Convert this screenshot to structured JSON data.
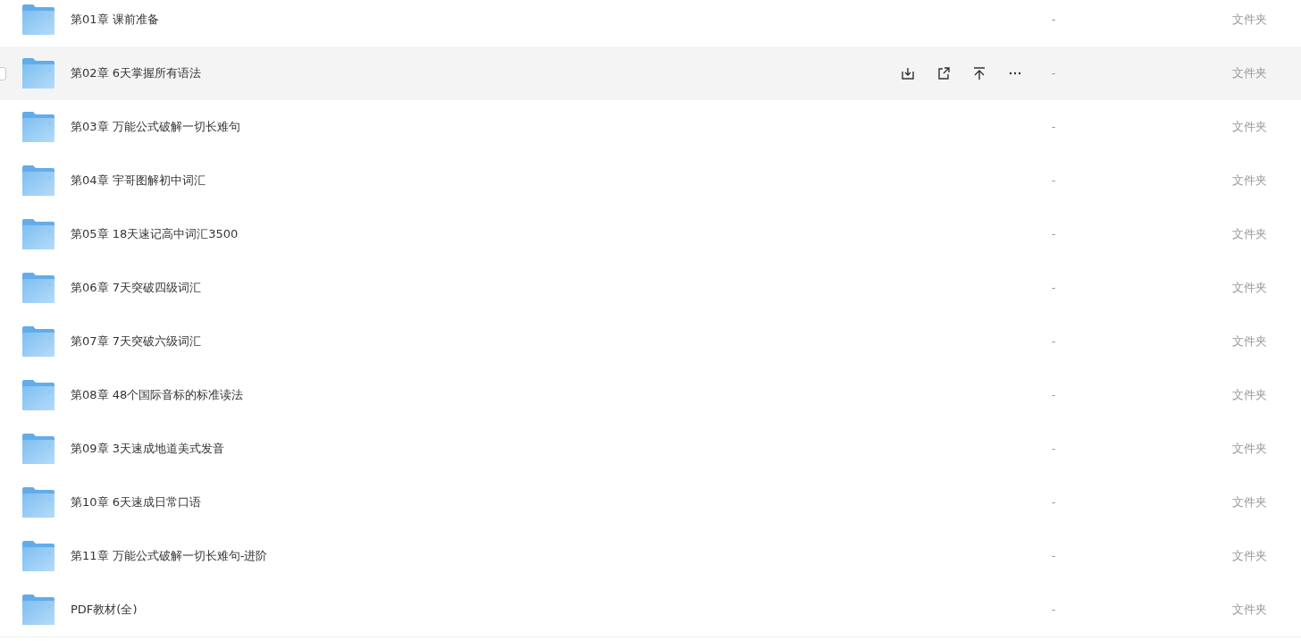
{
  "files": [
    {
      "name": "第01章 课前准备",
      "size": "-",
      "type": "文件夹",
      "hovered": false
    },
    {
      "name": "第02章 6天掌握所有语法",
      "size": "-",
      "type": "文件夹",
      "hovered": true
    },
    {
      "name": "第03章 万能公式破解一切长难句",
      "size": "-",
      "type": "文件夹",
      "hovered": false
    },
    {
      "name": "第04章 宇哥图解初中词汇",
      "size": "-",
      "type": "文件夹",
      "hovered": false
    },
    {
      "name": "第05章 18天速记高中词汇3500",
      "size": "-",
      "type": "文件夹",
      "hovered": false
    },
    {
      "name": "第06章 7天突破四级词汇",
      "size": "-",
      "type": "文件夹",
      "hovered": false
    },
    {
      "name": "第07章 7天突破六级词汇",
      "size": "-",
      "type": "文件夹",
      "hovered": false
    },
    {
      "name": "第08章 48个国际音标的标准读法",
      "size": "-",
      "type": "文件夹",
      "hovered": false
    },
    {
      "name": "第09章 3天速成地道美式发音",
      "size": "-",
      "type": "文件夹",
      "hovered": false
    },
    {
      "name": "第10章 6天速成日常口语",
      "size": "-",
      "type": "文件夹",
      "hovered": false
    },
    {
      "name": "第11章 万能公式破解一切长难句-进阶",
      "size": "-",
      "type": "文件夹",
      "hovered": false
    },
    {
      "name": "PDF教材(全)",
      "size": "-",
      "type": "文件夹",
      "hovered": false
    }
  ]
}
